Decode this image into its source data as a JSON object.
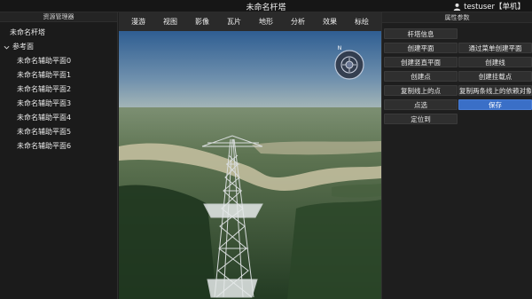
{
  "app": {
    "title": "未命名杆塔",
    "user": "testuser【单机】"
  },
  "left_panel": {
    "header": "资源管理器",
    "tree": [
      {
        "label": "未命名杆塔",
        "level": 0
      },
      {
        "label": "参考面",
        "level": 0,
        "expanded": true
      },
      {
        "label": "未命名辅助平面0",
        "level": 1
      },
      {
        "label": "未命名辅助平面1",
        "level": 1
      },
      {
        "label": "未命名辅助平面2",
        "level": 1
      },
      {
        "label": "未命名辅助平面3",
        "level": 1
      },
      {
        "label": "未命名辅助平面4",
        "level": 1
      },
      {
        "label": "未命名辅助平面5",
        "level": 1
      },
      {
        "label": "未命名辅助平面6",
        "level": 1
      }
    ]
  },
  "menu": [
    "漫游",
    "视图",
    "影像",
    "瓦片",
    "地形",
    "分析",
    "效果",
    "标绘"
  ],
  "compass": {
    "north_label": "N"
  },
  "right_panel": {
    "header": "属性参数",
    "buttons": [
      "杆塔信息",
      "创建平面",
      "通过菜单创建平面",
      "创建竖直平面",
      "创建线",
      "创建点",
      "创建挂载点",
      "复制线上的点",
      "复制两条线上的依赖对象",
      "点选",
      "保存",
      "定位到"
    ]
  },
  "colors": {
    "accent": "#3a6fc7",
    "panel_bg": "#1e1e1e",
    "menu_bg": "#2a2a2a"
  }
}
